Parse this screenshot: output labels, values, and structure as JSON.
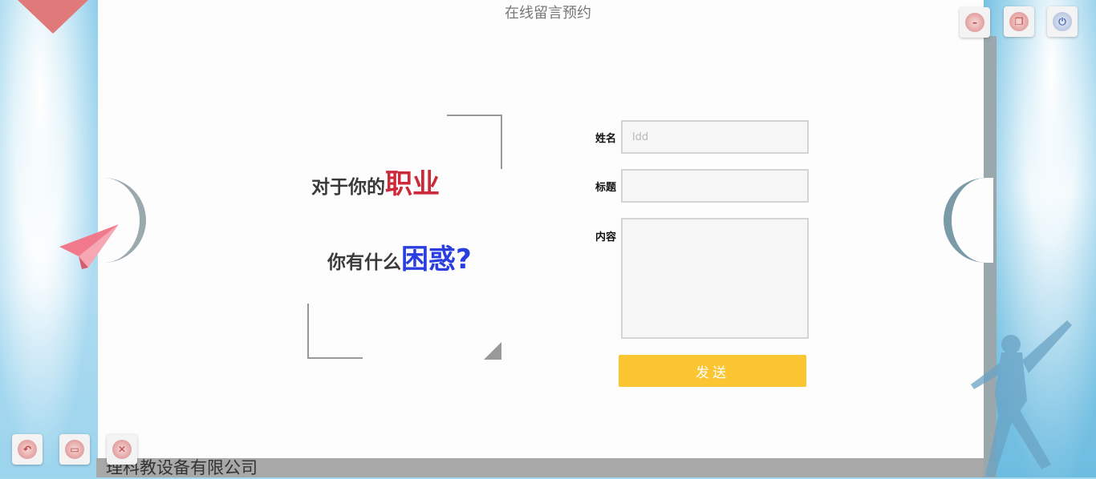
{
  "page": {
    "title": "在线留言预约",
    "company": "理科教设备有限公司"
  },
  "window_controls": [
    {
      "name": "minimize",
      "icon": "minimize-icon"
    },
    {
      "name": "restore",
      "icon": "restore-icon"
    },
    {
      "name": "power",
      "icon": "power-icon"
    }
  ],
  "nav_controls": [
    {
      "name": "back",
      "icon": "back-arrow-icon"
    },
    {
      "name": "keyboard",
      "icon": "keyboard-icon"
    },
    {
      "name": "close",
      "icon": "close-icon"
    }
  ],
  "slogan": {
    "line1_prefix": "对于你的",
    "line1_emphasis": "职业",
    "line2_prefix": "你有什么",
    "line2_emphasis": "困惑?"
  },
  "form": {
    "name_label": "姓名",
    "name_placeholder": "ldd",
    "name_value": "",
    "subject_label": "标题",
    "subject_value": "",
    "content_label": "内容",
    "content_value": "",
    "submit_label": "发送"
  },
  "colors": {
    "accent": "#fbc532",
    "emphasis_red": "#cc2a3a",
    "emphasis_blue": "#2a3ee0"
  }
}
